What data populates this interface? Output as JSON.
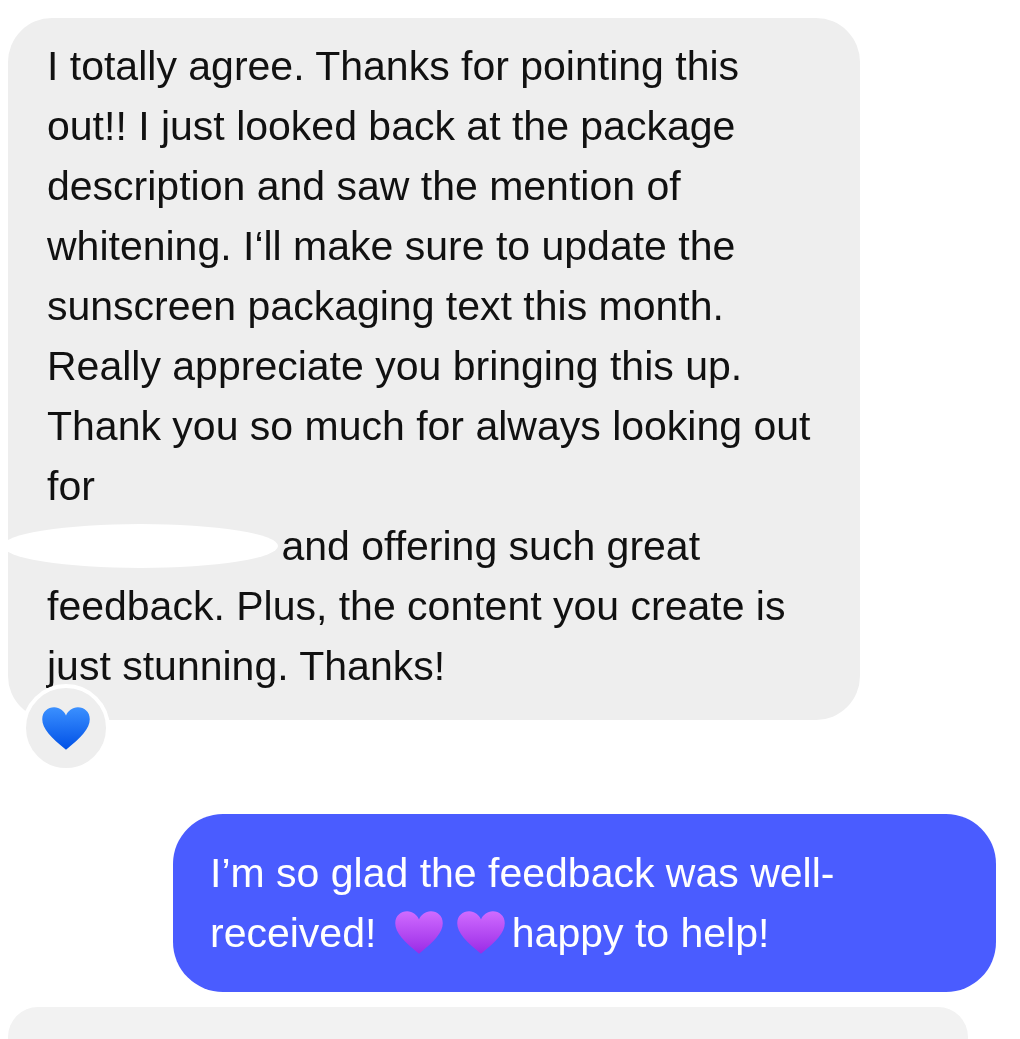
{
  "messages": [
    {
      "kind": "incoming",
      "segments": [
        {
          "kind": "text",
          "text": "I totally agree. Thanks for pointing this out!! I just looked back at the package description and saw the mention of whitening. I‘ll make sure to update the sunscreen packaging text this month. Really appreciate you bringing this up. Thank you so much for always looking out for"
        },
        {
          "kind": "redaction"
        },
        {
          "kind": "text",
          "text": "and offering such great"
        },
        {
          "kind": "text",
          "text": "feedback. Plus, the content you create is just stunning. Thanks!"
        }
      ],
      "reacted": true
    },
    {
      "kind": "outgoing",
      "segments": [
        {
          "kind": "text",
          "text": "I’m so glad the feedback was well-"
        },
        {
          "kind": "text",
          "text": "received!"
        },
        {
          "kind": "heart"
        },
        {
          "kind": "heart"
        },
        {
          "kind": "text",
          "text": "happy to help!"
        }
      ]
    },
    {
      "kind": "incoming"
    }
  ]
}
